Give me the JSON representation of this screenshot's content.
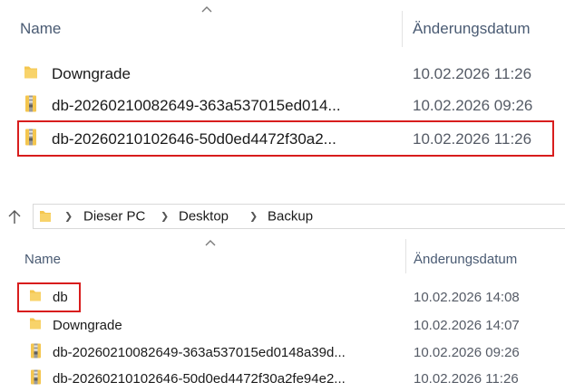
{
  "top_pane": {
    "columns": {
      "name": "Name",
      "date": "Änderungsdatum"
    },
    "rows": [
      {
        "name": "Downgrade",
        "date": "10.02.2026 11:26",
        "icon": "folder-icon"
      },
      {
        "name": "db-20260210082649-363a537015ed014...",
        "date": "10.02.2026 09:26",
        "icon": "zip-folder-icon"
      },
      {
        "name": "db-20260210102646-50d0ed4472f30a2...",
        "date": "10.02.2026 11:26",
        "icon": "zip-folder-icon",
        "highlighted": true
      }
    ]
  },
  "address_bar": {
    "up_icon": "up-arrow-icon",
    "breadcrumbs": [
      "Dieser PC",
      "Desktop",
      "Backup"
    ]
  },
  "bottom_pane": {
    "columns": {
      "name": "Name",
      "date": "Änderungsdatum"
    },
    "rows": [
      {
        "name": "db",
        "date": "10.02.2026 14:08",
        "icon": "folder-icon",
        "highlighted": true
      },
      {
        "name": "Downgrade",
        "date": "10.02.2026 14:07",
        "icon": "folder-icon"
      },
      {
        "name": "db-20260210082649-363a537015ed0148a39d...",
        "date": "10.02.2026 09:26",
        "icon": "zip-folder-icon"
      },
      {
        "name": "db-20260210102646-50d0ed4472f30a2fe94e2...",
        "date": "10.02.2026 11:26",
        "icon": "zip-folder-icon"
      }
    ]
  },
  "colors": {
    "highlight": "#d81d1d",
    "folder": "#f4c64f",
    "header_text": "#4a5b73"
  }
}
